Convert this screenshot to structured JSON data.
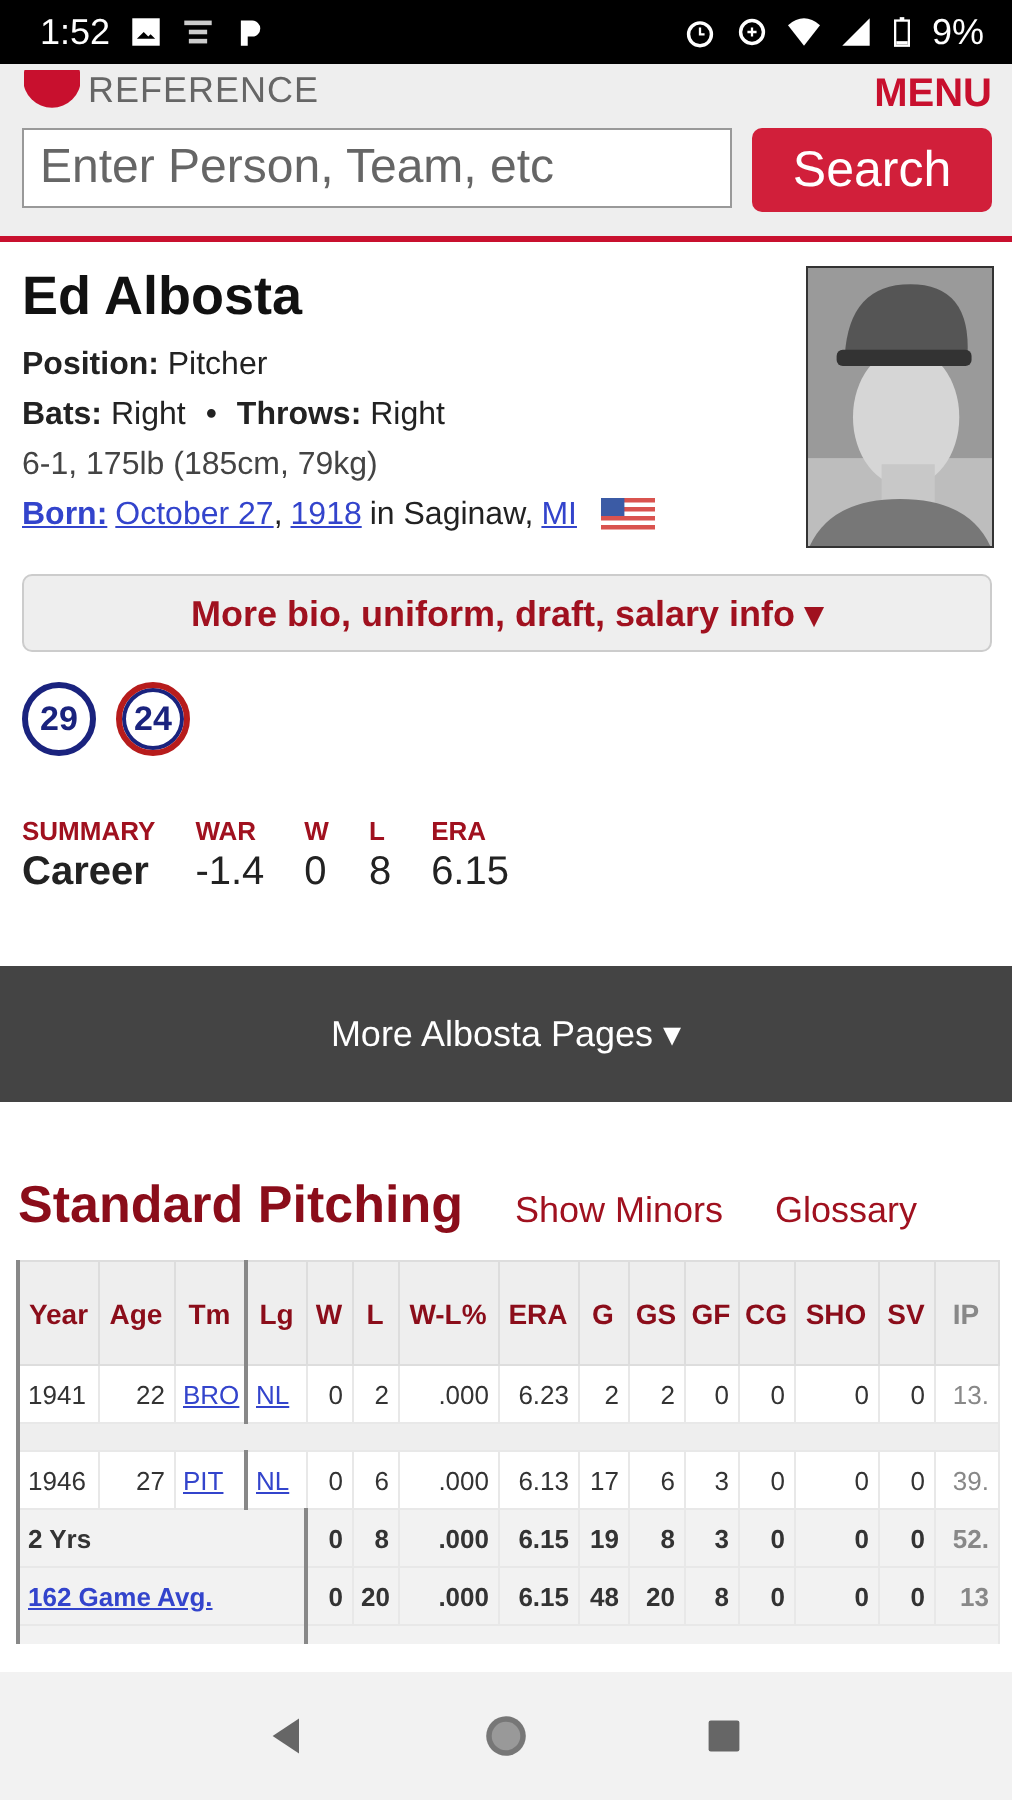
{
  "status_bar": {
    "time": "1:52",
    "battery": "9%"
  },
  "header": {
    "logo": "REFERENCE",
    "menu": "MENU"
  },
  "search": {
    "placeholder": "Enter Person, Team, etc",
    "button": "Search"
  },
  "player": {
    "name": "Ed Albosta",
    "lines": [
      {
        "kind": "pair",
        "items": [
          {
            "label": "Position:",
            "value": "Pitcher"
          }
        ]
      },
      {
        "kind": "pair",
        "separator": "•",
        "items": [
          {
            "label": "Bats:",
            "value": "Right"
          },
          {
            "label": "Throws:",
            "value": "Right"
          }
        ]
      },
      {
        "kind": "plain",
        "text": "6-1, 175lb (185cm, 79kg)"
      },
      {
        "kind": "born",
        "label": "Born:",
        "date": "October 27",
        "comma": ",",
        "year": "1918",
        "place": "in Saginaw,",
        "state": "MI"
      }
    ],
    "more_button": "More bio, uniform, draft, salary info ▾"
  },
  "uniforms": [
    {
      "number": "29",
      "color": "#1a237e"
    },
    {
      "number": "24",
      "color": "#b71c1c"
    }
  ],
  "summary": {
    "columns": [
      "SUMMARY",
      "WAR",
      "W",
      "L",
      "ERA"
    ],
    "row": [
      "Career",
      "-1.4",
      "0",
      "8",
      "6.15"
    ]
  },
  "more_pages": "More Albosta Pages ▾",
  "section": {
    "title": "Standard Pitching",
    "links": [
      "Show Minors",
      "Glossary"
    ]
  },
  "table": {
    "columns": [
      "Year",
      "Age",
      "Tm",
      "Lg",
      "W",
      "L",
      "W-L%",
      "ERA",
      "G",
      "GS",
      "GF",
      "CG",
      "SHO",
      "SV",
      "IP"
    ],
    "rows": [
      {
        "kind": "season",
        "cells": [
          {
            "text": "1941"
          },
          {
            "text": "22"
          },
          {
            "text": "BRO",
            "link": true
          },
          {
            "text": "NL",
            "link": true
          },
          {
            "text": "0"
          },
          {
            "text": "2"
          },
          {
            "text": ".000"
          },
          {
            "text": "6.23"
          },
          {
            "text": "2"
          },
          {
            "text": "2"
          },
          {
            "text": "0"
          },
          {
            "text": "0"
          },
          {
            "text": "0"
          },
          {
            "text": "0"
          },
          {
            "text": "13."
          }
        ]
      },
      {
        "kind": "season",
        "cells": [
          {
            "text": "1946"
          },
          {
            "text": "27"
          },
          {
            "text": "PIT",
            "link": true
          },
          {
            "text": "NL",
            "link": true
          },
          {
            "text": "0"
          },
          {
            "text": "6"
          },
          {
            "text": ".000"
          },
          {
            "text": "6.13"
          },
          {
            "text": "17"
          },
          {
            "text": "6"
          },
          {
            "text": "3"
          },
          {
            "text": "0"
          },
          {
            "text": "0"
          },
          {
            "text": "0"
          },
          {
            "text": "39."
          }
        ]
      },
      {
        "kind": "total",
        "cells": [
          {
            "text": "2 Yrs",
            "colspan": 4
          },
          {
            "text": "0"
          },
          {
            "text": "8"
          },
          {
            "text": ".000"
          },
          {
            "text": "6.15"
          },
          {
            "text": "19"
          },
          {
            "text": "8"
          },
          {
            "text": "3"
          },
          {
            "text": "0"
          },
          {
            "text": "0"
          },
          {
            "text": "0"
          },
          {
            "text": "52."
          }
        ]
      },
      {
        "kind": "total",
        "cells": [
          {
            "text": "162 Game Avg.",
            "link": true,
            "colspan": 4
          },
          {
            "text": "0"
          },
          {
            "text": "20"
          },
          {
            "text": ".000"
          },
          {
            "text": "6.15"
          },
          {
            "text": "48"
          },
          {
            "text": "20"
          },
          {
            "text": "8"
          },
          {
            "text": "0"
          },
          {
            "text": "0"
          },
          {
            "text": "0"
          },
          {
            "text": "13"
          }
        ]
      }
    ]
  }
}
